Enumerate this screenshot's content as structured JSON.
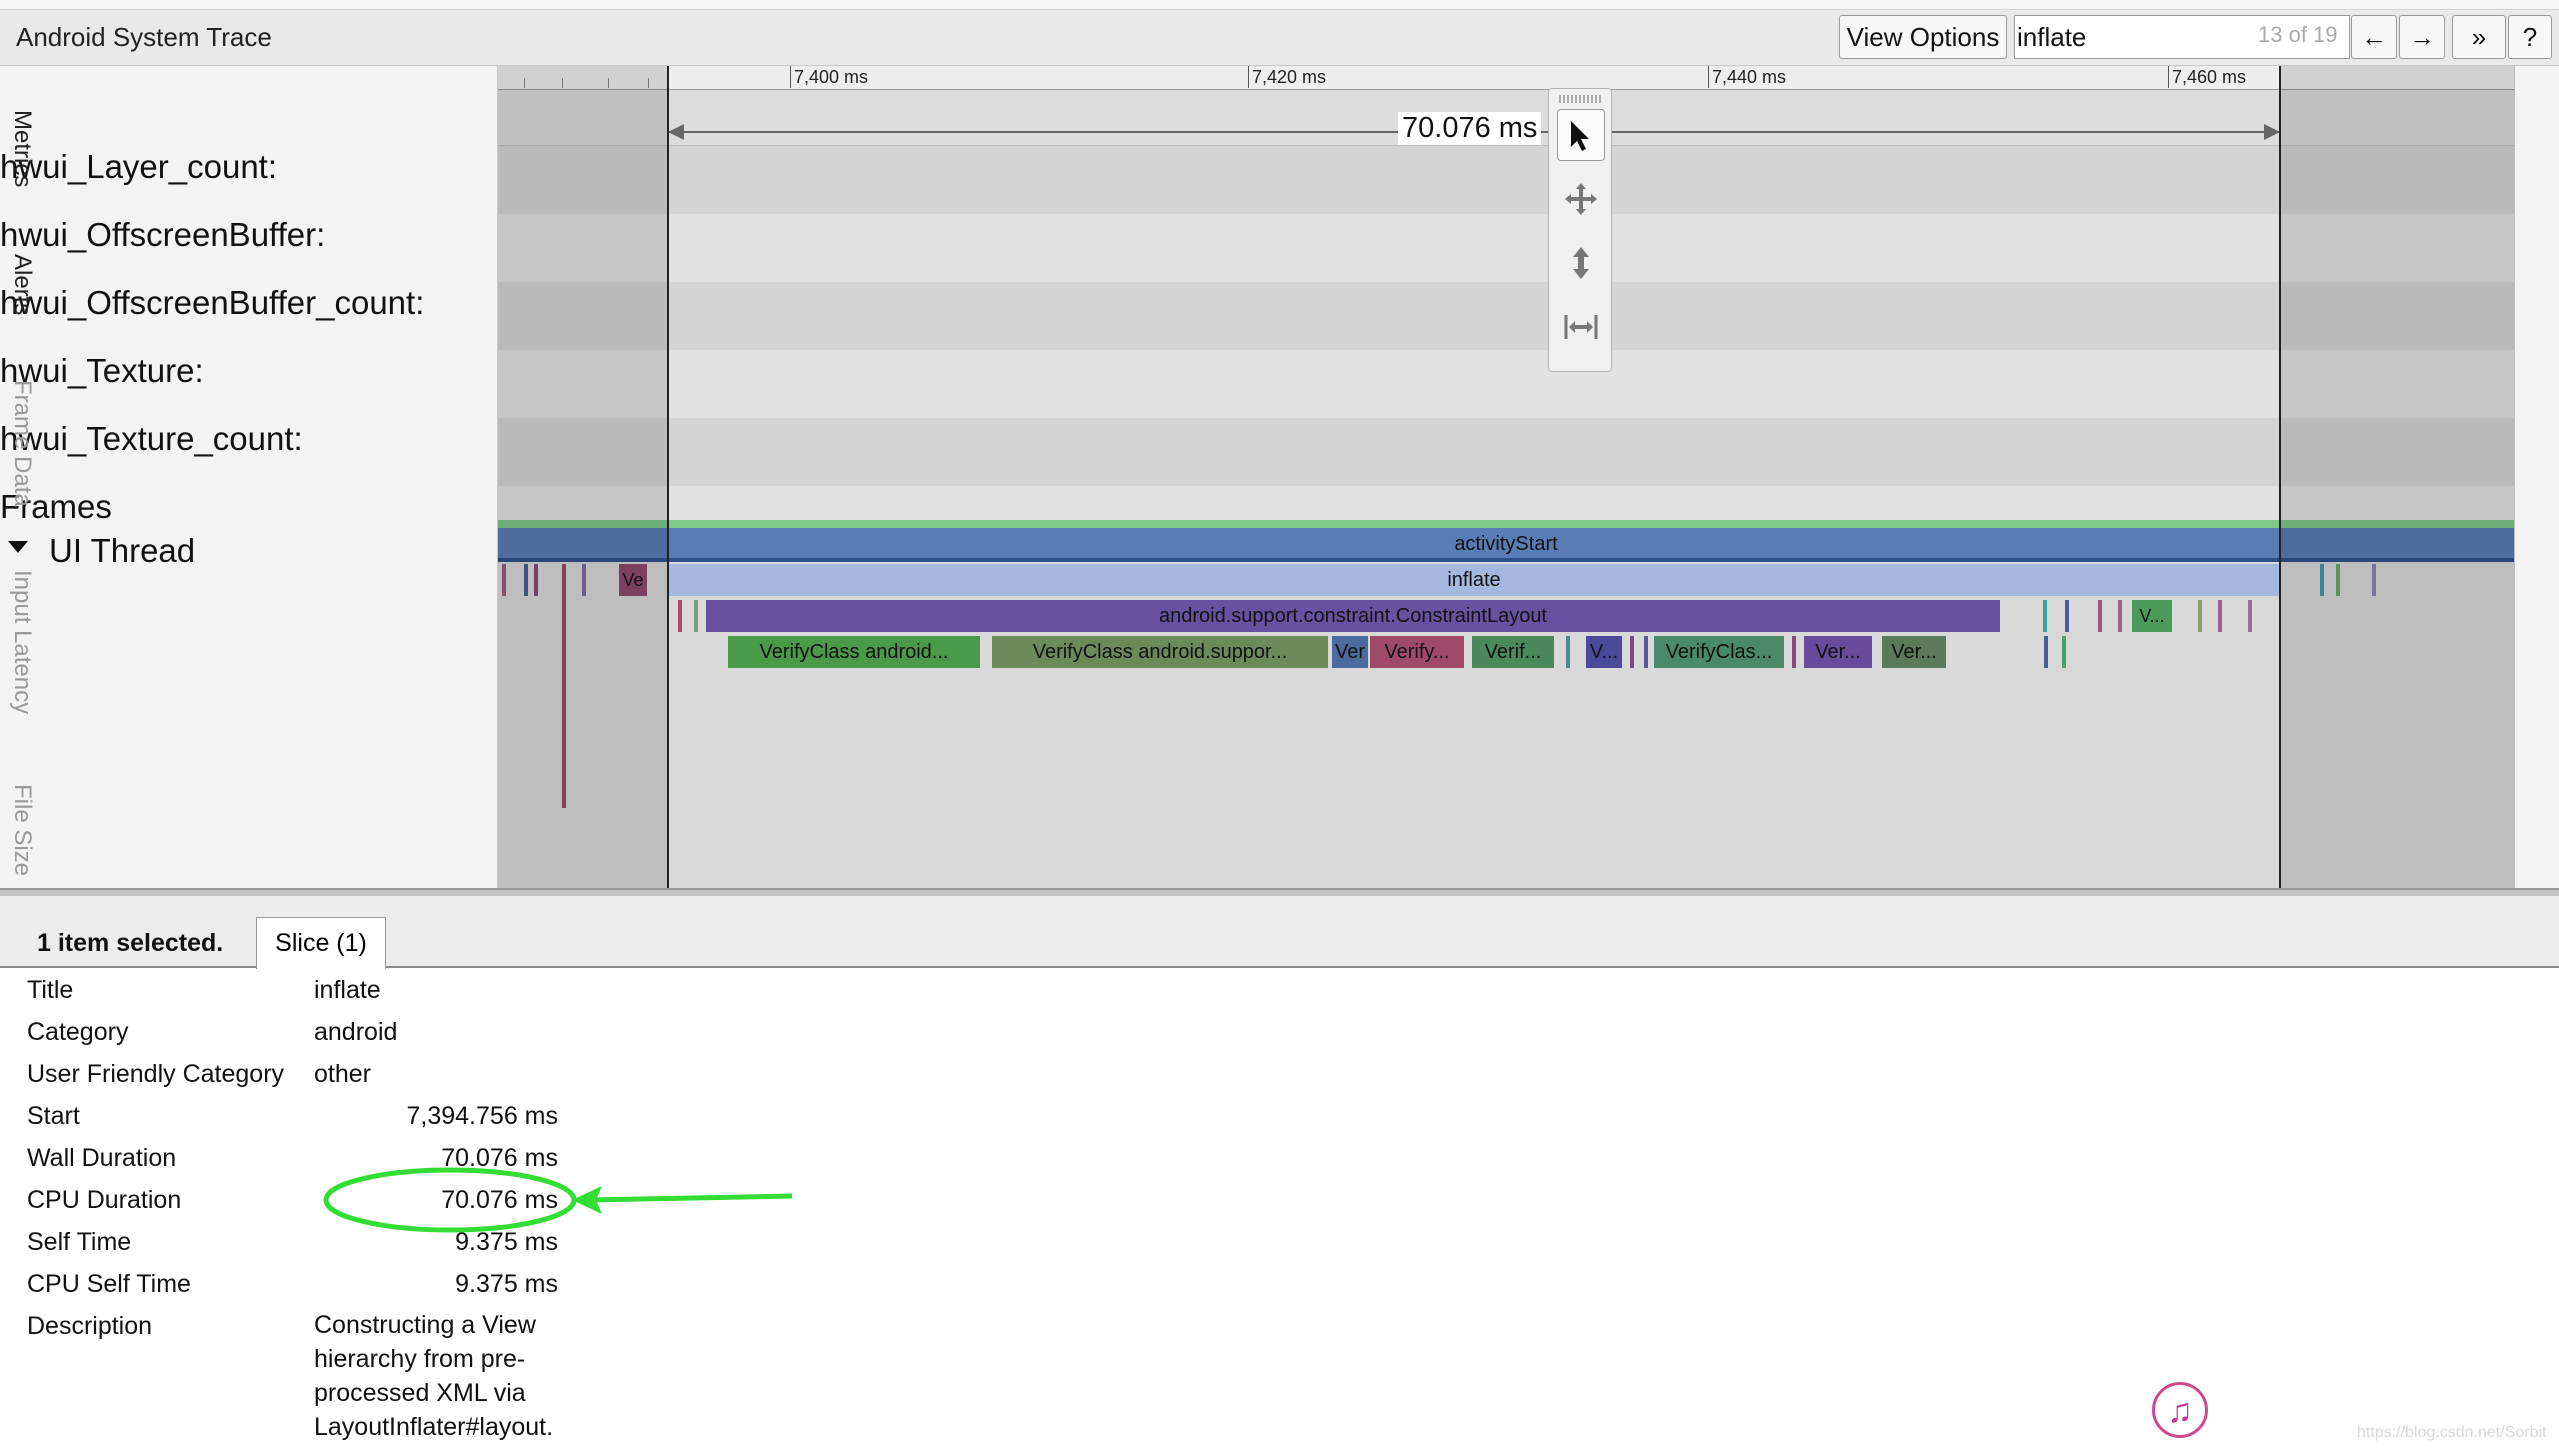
{
  "topbar": {
    "title": "Android System Trace",
    "view_options": "View Options",
    "search_value": "inflate",
    "search_count": "13 of 19",
    "prev_label": "←",
    "next_label": "→",
    "expand_label": "»",
    "help_label": "?"
  },
  "tracks": [
    "hwui_Layer_count:",
    "hwui_OffscreenBuffer:",
    "hwui_OffscreenBuffer_count:",
    "hwui_Texture:",
    "hwui_Texture_count:",
    "Frames",
    "UI Thread"
  ],
  "ruler": {
    "ticks": [
      "7,400 ms",
      "7,420 ms",
      "7,440 ms",
      "7,460 ms"
    ]
  },
  "measurement": "70.076 ms",
  "slices": {
    "activity_start": "activityStart",
    "inflate": "inflate",
    "constraint_layout": "android.support.constraint.ConstraintLayout",
    "ve_small": "Ve",
    "v_right": "V...",
    "verify": [
      "VerifyClass android...",
      "VerifyClass android.suppor...",
      "Ver",
      "Verify...",
      "Verif...",
      "V...",
      "VerifyClas...",
      "Ver...",
      "Ver..."
    ]
  },
  "side_tabs": [
    "Metrics",
    "Alerts",
    "Frame Data",
    "Input Latency",
    "File Size"
  ],
  "analysis": {
    "selected_count": "1 item selected.",
    "tab_label": "Slice (1)",
    "rows": {
      "title": {
        "key": "Title",
        "value": "inflate"
      },
      "category": {
        "key": "Category",
        "value": "android"
      },
      "user_category": {
        "key": "User Friendly Category",
        "value": "other"
      },
      "start": {
        "key": "Start",
        "value": "7,394.756 ms"
      },
      "wall_duration": {
        "key": "Wall Duration",
        "value": "70.076 ms"
      },
      "cpu_duration": {
        "key": "CPU Duration",
        "value": "70.076 ms"
      },
      "self_time": {
        "key": "Self Time",
        "value": "9.375 ms"
      },
      "cpu_self_time": {
        "key": "CPU Self Time",
        "value": "9.375 ms"
      },
      "description": {
        "key": "Description",
        "value": "Constructing a View hierarchy from pre-processed XML via LayoutInflater#layout."
      }
    }
  },
  "annotation_color": "#33dd33",
  "watermark": "https://blog.csdn.net/Sorbit"
}
